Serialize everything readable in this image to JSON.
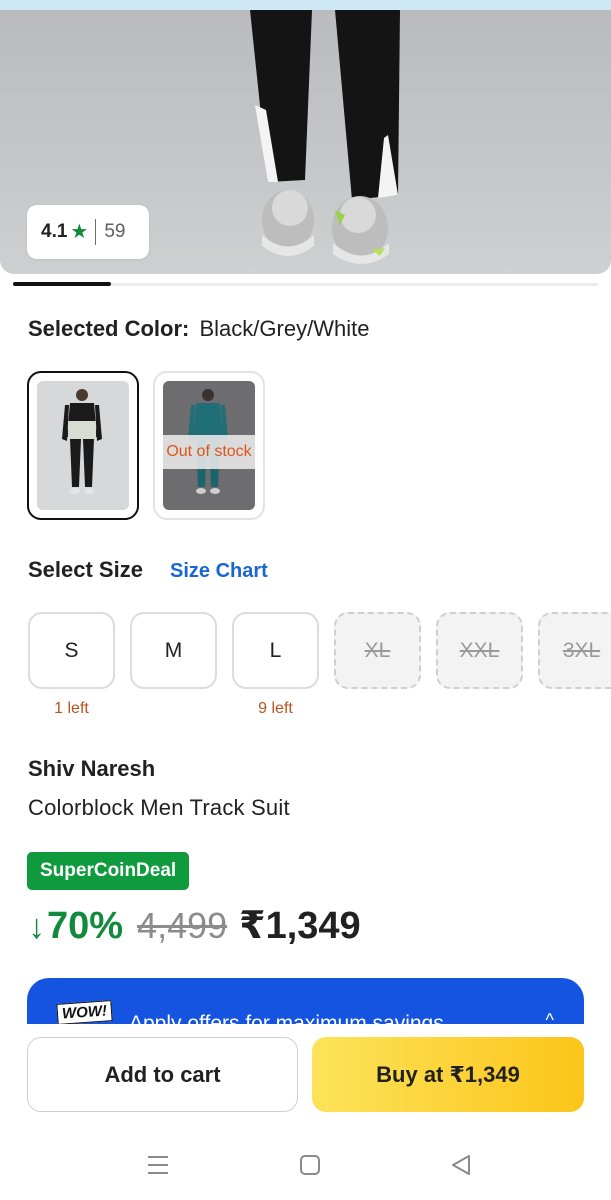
{
  "hero": {
    "rating": "4.1",
    "rating_star": "★",
    "review_count": "59",
    "carousel_position": 1
  },
  "color": {
    "label": "Selected Color:",
    "value": "Black/Grey/White",
    "swatches": [
      {
        "name": "Black/Grey/White",
        "selected": true,
        "status": ""
      },
      {
        "name": "Teal",
        "selected": false,
        "status": "Out of stock"
      }
    ]
  },
  "size": {
    "title": "Select Size",
    "chart_link": "Size Chart",
    "options": [
      {
        "label": "S",
        "available": true,
        "note": "1 left"
      },
      {
        "label": "M",
        "available": true,
        "note": ""
      },
      {
        "label": "L",
        "available": true,
        "note": "9 left"
      },
      {
        "label": "XL",
        "available": false,
        "note": ""
      },
      {
        "label": "XXL",
        "available": false,
        "note": ""
      },
      {
        "label": "3XL",
        "available": false,
        "note": ""
      }
    ]
  },
  "product": {
    "brand": "Shiv Naresh",
    "title": "Colorblock Men Track Suit",
    "badge": "SuperCoinDeal",
    "discount_arrow": "↓",
    "discount": "70%",
    "mrp": "4,499",
    "price": "₹1,349"
  },
  "offers": {
    "wow_label": "WOW!",
    "text": "Apply offers for maximum savings",
    "caret": "^"
  },
  "actions": {
    "add_to_cart": "Add to cart",
    "buy_now": "Buy at ₹1,349"
  },
  "colors": {
    "accent_green": "#118a3c",
    "link_blue": "#1a66d1",
    "offer_blue": "#1454e0",
    "buy_yellow": "#fbc51a",
    "stock_orange": "#e0541c"
  }
}
